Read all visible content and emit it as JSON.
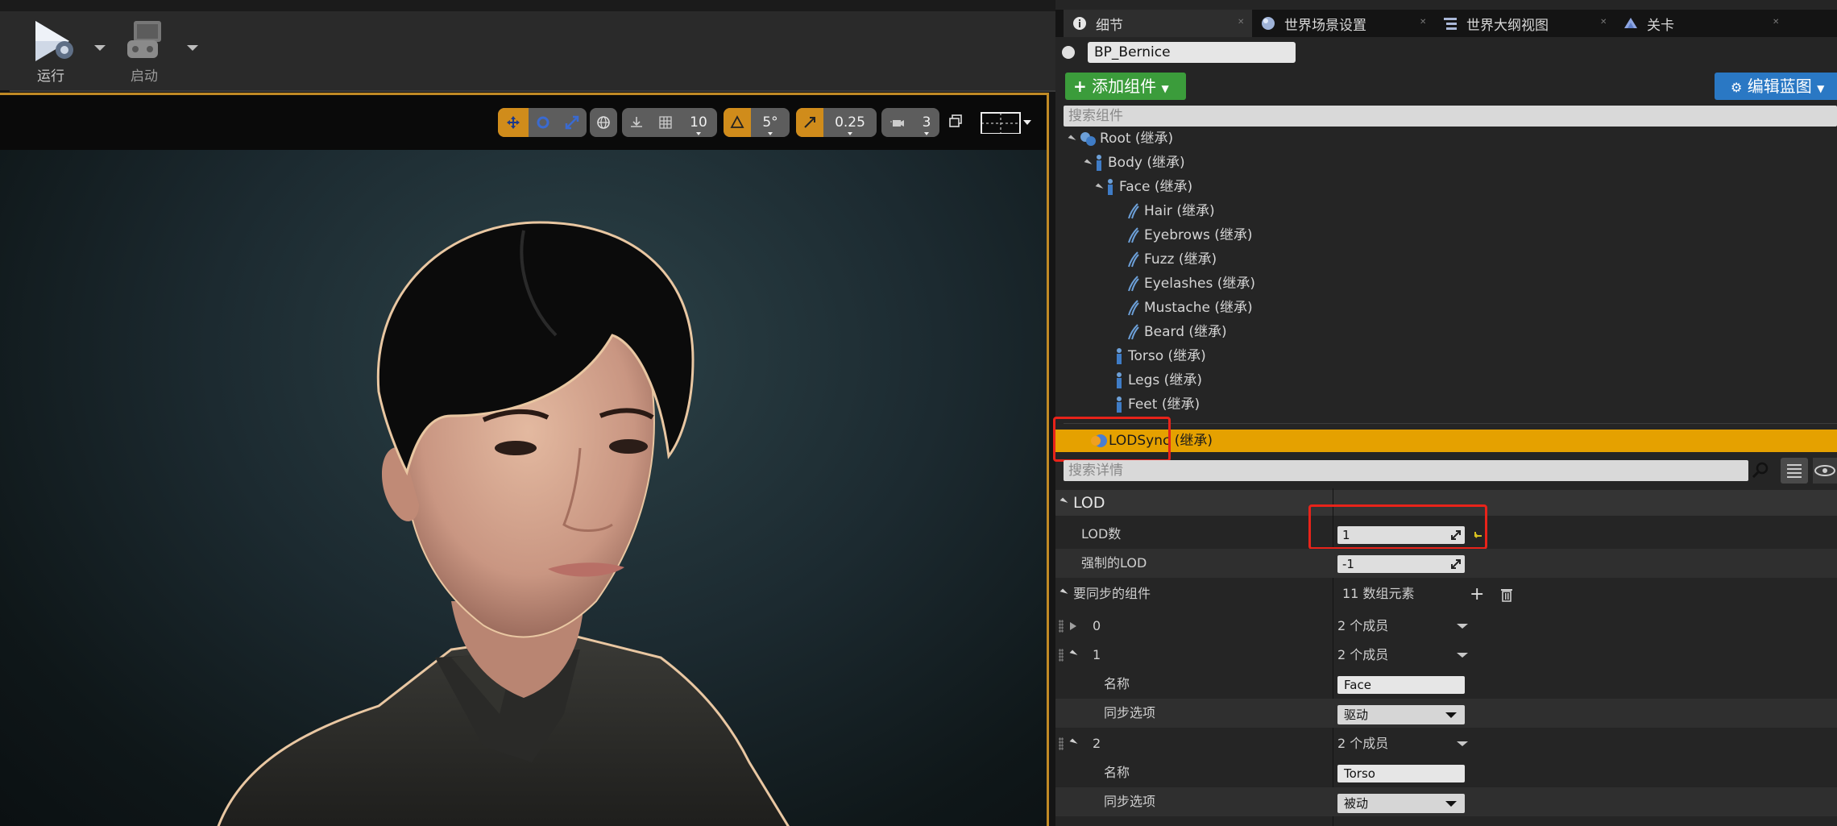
{
  "toolbar": {
    "play_label": "运行",
    "launch_label": "启动"
  },
  "viewport_toolbar": {
    "grid_snap_value": "10",
    "rotation_snap_value": "5°",
    "scale_snap_value": "0.25",
    "camera_speed_value": "3"
  },
  "tabs": [
    {
      "label": "细节",
      "icon": "info-icon"
    },
    {
      "label": "世界场景设置",
      "icon": "globe-icon"
    },
    {
      "label": "世界大纲视图",
      "icon": "outliner-icon"
    },
    {
      "label": "关卡",
      "icon": "level-icon"
    }
  ],
  "actor_name": "BP_Bernice",
  "add_component_label": "添加组件",
  "edit_blueprint_label": "编辑蓝图",
  "search_components_placeholder": "搜索组件",
  "component_tree": [
    {
      "label": "Root (继承)"
    },
    {
      "label": "Body (继承)"
    },
    {
      "label": "Face (继承)"
    },
    {
      "label": "Hair (继承)"
    },
    {
      "label": "Eyebrows (继承)"
    },
    {
      "label": "Fuzz (继承)"
    },
    {
      "label": "Eyelashes (继承)"
    },
    {
      "label": "Mustache (继承)"
    },
    {
      "label": "Beard (继承)"
    },
    {
      "label": "Torso (继承)"
    },
    {
      "label": "Legs (继承)"
    },
    {
      "label": "Feet (继承)"
    }
  ],
  "selected_component": "LODSync (继承)",
  "search_details_placeholder": "搜索详情",
  "details": {
    "category": "LOD",
    "lod_count_label": "LOD数",
    "lod_count_value": "1",
    "forced_lod_label": "强制的LOD",
    "forced_lod_value": "-1",
    "components_to_sync_label": "要同步的组件",
    "components_to_sync_value": "11 数组元素",
    "elements": [
      {
        "index": "0",
        "members": "2 个成员"
      },
      {
        "index": "1",
        "members": "2 个成员",
        "name_label": "名称",
        "name_value": "Face",
        "sync_label": "同步选项",
        "sync_value": "驱动"
      },
      {
        "index": "2",
        "members": "2 个成员",
        "name_label": "名称",
        "name_value": "Torso",
        "sync_label": "同步选项",
        "sync_value": "被动"
      }
    ]
  },
  "colors": {
    "selection_highlight": "#e5a100",
    "add_component_green": "#3b9c3b",
    "edit_blueprint_blue": "#2a78c4",
    "annotation_red": "#e8231a",
    "viewport_border": "#c08a25"
  }
}
